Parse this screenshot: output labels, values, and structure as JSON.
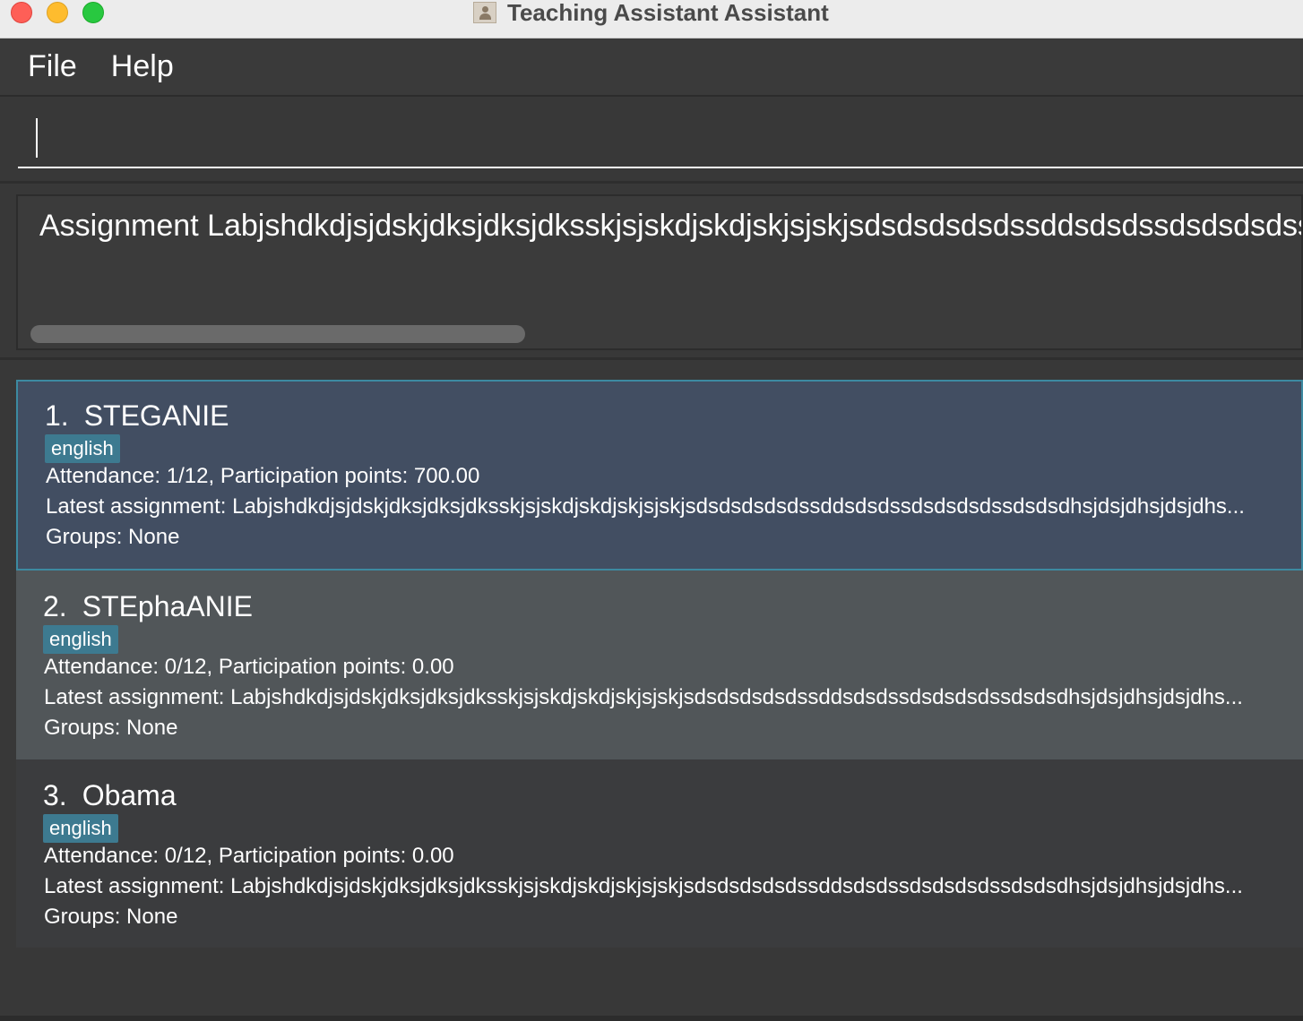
{
  "window": {
    "title": "Teaching Assistant Assistant"
  },
  "menu": {
    "items": [
      {
        "label": "File"
      },
      {
        "label": "Help"
      }
    ]
  },
  "command_box": {
    "value": ""
  },
  "result_display": {
    "text": "Assignment Labjshdkdjsjdskjdksjdksjdksskjsjskdjskdjskjsjskjsdsdsdsdsdssddsdsdssdsdsdsdssdsdsdsdsdsdsdsdsd"
  },
  "students": [
    {
      "index": "1.",
      "name": "STEGANIE",
      "tag": "english",
      "attendance": "Attendance: 1/12, Participation points: 700.00",
      "latest_assignment": "Latest assignment: Labjshdkdjsjdskjdksjdksjdksskjsjskdjskdjskjsjskjsdsdsdsdsdssddsdsdssdsdsdsdssdsdsdhsjdsjdhsjdsjdhs...",
      "groups": "Groups: None",
      "selected": true
    },
    {
      "index": "2.",
      "name": "STEphaANIE",
      "tag": "english",
      "attendance": "Attendance: 0/12, Participation points: 0.00",
      "latest_assignment": "Latest assignment: Labjshdkdjsjdskjdksjdksjdksskjsjskdjskdjskjsjskjsdsdsdsdsdssddsdsdssdsdsdsdssdsdsdhsjdsjdhsjdsjdhs...",
      "groups": "Groups: None",
      "selected": false
    },
    {
      "index": "3.",
      "name": "Obama",
      "tag": "english",
      "attendance": "Attendance: 0/12, Participation points: 0.00",
      "latest_assignment": "Latest assignment: Labjshdkdjsjdskjdksjdksjdksskjsjskdjskdjskjsjskjsdsdsdsdsdssddsdsdssdsdsdsdssdsdsdhsjdsjdhsjdsjdhs...",
      "groups": "Groups: None",
      "selected": false
    }
  ],
  "colors": {
    "background": "#383838",
    "selected_card": "#424e62",
    "selected_border": "#3d8aa1",
    "card_alt": "#515659",
    "card_dark": "#3b3c3e",
    "tag": "#3d7a90",
    "text": "#ffffff"
  }
}
